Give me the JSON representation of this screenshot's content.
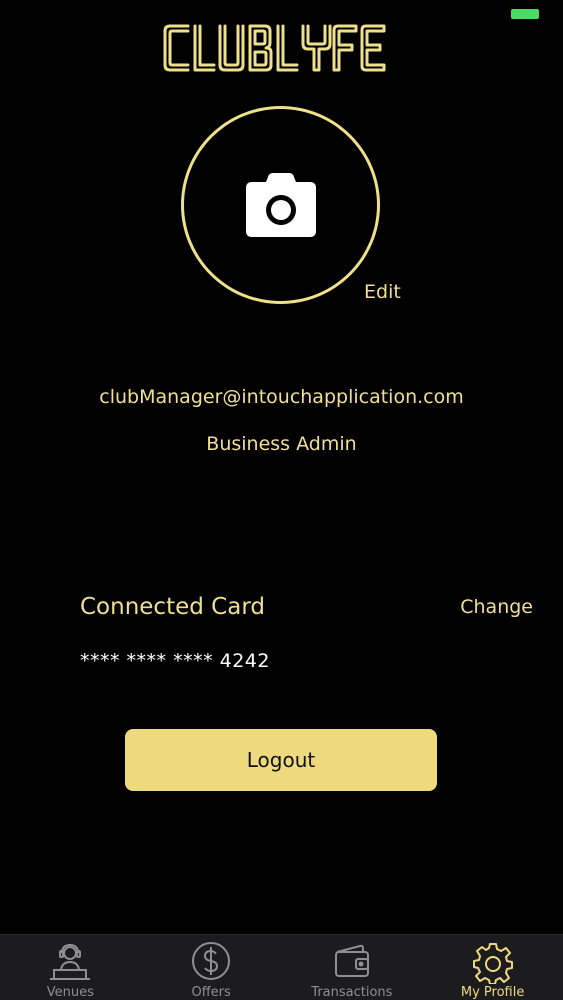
{
  "app": {
    "logo_text": "CLUBLYFE"
  },
  "profile": {
    "edit_label": "Edit",
    "email": "clubManager@intouchapplication.com",
    "role": "Business Admin"
  },
  "card": {
    "title": "Connected Card",
    "change_label": "Change",
    "number": "**** **** **** 4242"
  },
  "actions": {
    "logout_label": "Logout"
  },
  "tabbar": {
    "items": [
      {
        "label": "Venues",
        "icon": "dj-icon",
        "active": false
      },
      {
        "label": "Offers",
        "icon": "dollar-icon",
        "active": false
      },
      {
        "label": "Transactions",
        "icon": "wallet-icon",
        "active": false
      },
      {
        "label": "My Profile",
        "icon": "gear-icon",
        "active": true
      }
    ]
  },
  "colors": {
    "accent": "#efd97d",
    "background": "#000000",
    "tab_inactive": "#8e8e93",
    "battery": "#4cd964"
  }
}
